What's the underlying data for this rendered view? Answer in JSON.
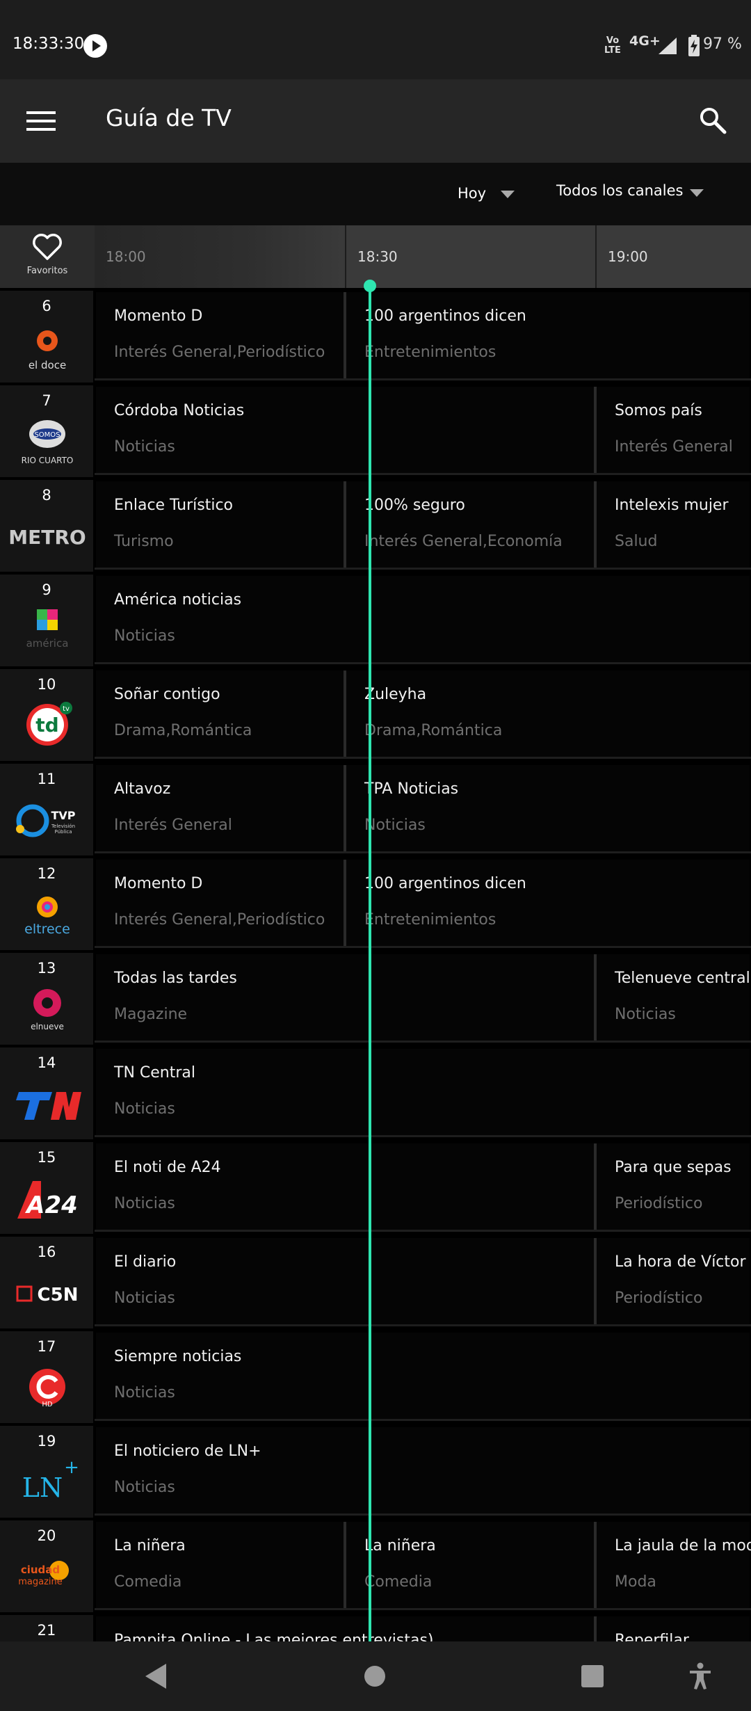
{
  "status_bar": {
    "time": "18:33:30",
    "volte_top": "Vo",
    "volte_bottom": "LTE",
    "network": "4G+",
    "battery": "97 %"
  },
  "app_bar": {
    "title": "Guía de TV"
  },
  "filters": {
    "day": "Hoy",
    "channels": "Todos los canales"
  },
  "time_header": {
    "favorites": "Favoritos",
    "slots": [
      "18:00",
      "18:30",
      "19:00"
    ]
  },
  "colors": {
    "now_line": "#2ee6b0",
    "background": "#000000",
    "app_bar": "#262626"
  },
  "channels": [
    {
      "number": "6",
      "logo": "el doce",
      "programs": [
        {
          "title": "Momento D",
          "genre": "Interés General,Periodístico"
        },
        {
          "title": "100 argentinos dicen",
          "genre": "Entretenimientos"
        }
      ]
    },
    {
      "number": "7",
      "logo": "SOMOS RIO CUARTO",
      "programs": [
        {
          "title": "Córdoba Noticias",
          "genre": "Noticias"
        },
        {
          "title": "Somos país",
          "genre": "Interés General"
        }
      ]
    },
    {
      "number": "8",
      "logo": "METRO",
      "programs": [
        {
          "title": "Enlace Turístico",
          "genre": "Turismo"
        },
        {
          "title": "100% seguro",
          "genre": "Interés General,Economía"
        },
        {
          "title": "Intelexis mujer",
          "genre": "Salud"
        }
      ]
    },
    {
      "number": "9",
      "logo": "américa",
      "programs": [
        {
          "title": "América noticias",
          "genre": "Noticias"
        }
      ]
    },
    {
      "number": "10",
      "logo": "td tv",
      "programs": [
        {
          "title": "Soñar contigo",
          "genre": "Drama,Romántica"
        },
        {
          "title": "Zuleyha",
          "genre": "Drama,Romántica"
        }
      ]
    },
    {
      "number": "11",
      "logo": "TVP Televisión Pública",
      "programs": [
        {
          "title": "Altavoz",
          "genre": "Interés General"
        },
        {
          "title": "TPA Noticias",
          "genre": "Noticias"
        }
      ]
    },
    {
      "number": "12",
      "logo": "eltrece",
      "programs": [
        {
          "title": "Momento D",
          "genre": "Interés General,Periodístico"
        },
        {
          "title": "100 argentinos dicen",
          "genre": "Entretenimientos"
        }
      ]
    },
    {
      "number": "13",
      "logo": "elnueve",
      "programs": [
        {
          "title": "Todas las tardes",
          "genre": "Magazine"
        },
        {
          "title": "Telenueve central",
          "genre": "Noticias"
        }
      ]
    },
    {
      "number": "14",
      "logo": "TN",
      "programs": [
        {
          "title": "TN Central",
          "genre": "Noticias"
        }
      ]
    },
    {
      "number": "15",
      "logo": "A24",
      "programs": [
        {
          "title": "El noti de A24",
          "genre": "Noticias"
        },
        {
          "title": "Para que sepas",
          "genre": "Periodístico"
        }
      ]
    },
    {
      "number": "16",
      "logo": "C5N",
      "programs": [
        {
          "title": "El diario",
          "genre": "Noticias"
        },
        {
          "title": "La hora de Víctor H",
          "genre": "Periodístico"
        }
      ]
    },
    {
      "number": "17",
      "logo": "HD",
      "programs": [
        {
          "title": "Siempre noticias",
          "genre": "Noticias"
        }
      ]
    },
    {
      "number": "19",
      "logo": "LN+",
      "programs": [
        {
          "title": "El noticiero de LN+",
          "genre": "Noticias"
        }
      ]
    },
    {
      "number": "20",
      "logo": "ciudad magazine",
      "programs": [
        {
          "title": "La niñera",
          "genre": "Comedia"
        },
        {
          "title": "La niñera",
          "genre": "Comedia"
        },
        {
          "title": "La jaula de la moda",
          "genre": "Moda"
        }
      ]
    },
    {
      "number": "21",
      "logo": "",
      "programs": [
        {
          "title": "Pampita Online - Las mejores entrevistas)",
          "genre": ""
        },
        {
          "title": "Reperfilar",
          "genre": ""
        }
      ]
    }
  ]
}
